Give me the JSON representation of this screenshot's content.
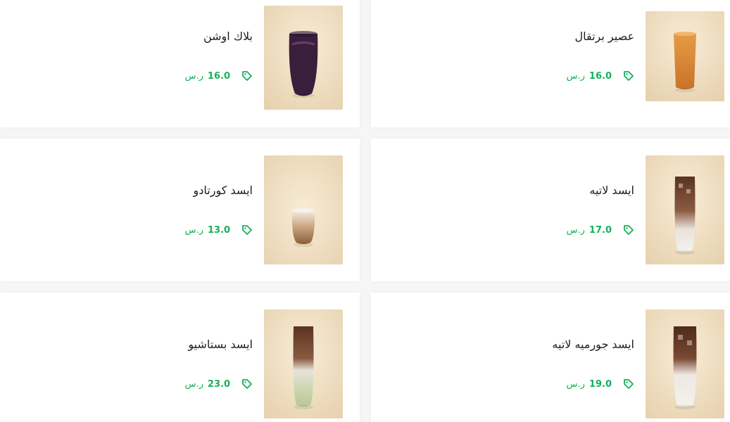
{
  "accent_color": "#15b05a",
  "items": [
    {
      "name": "بلاك اوشن",
      "price": "16.0",
      "currency": "ر.س",
      "tag_icon": "price-tag-icon",
      "drink": "dark-berry"
    },
    {
      "name": "عصير برتقال",
      "price": "16.0",
      "currency": "ر.س",
      "tag_icon": "price-tag-icon",
      "drink": "orange"
    },
    {
      "name": "ايسد كورتادو",
      "price": "13.0",
      "currency": "ر.س",
      "tag_icon": "price-tag-icon",
      "drink": "cortado"
    },
    {
      "name": "ايسد لاتيه",
      "price": "17.0",
      "currency": "ر.س",
      "tag_icon": "price-tag-icon",
      "drink": "latte"
    },
    {
      "name": "ايسد بستاشيو",
      "price": "23.0",
      "currency": "ر.س",
      "tag_icon": "price-tag-icon",
      "drink": "pistachio"
    },
    {
      "name": "ايسد جورميه لاتيه",
      "price": "19.0",
      "currency": "ر.س",
      "tag_icon": "price-tag-icon",
      "drink": "gourmet-latte"
    }
  ]
}
